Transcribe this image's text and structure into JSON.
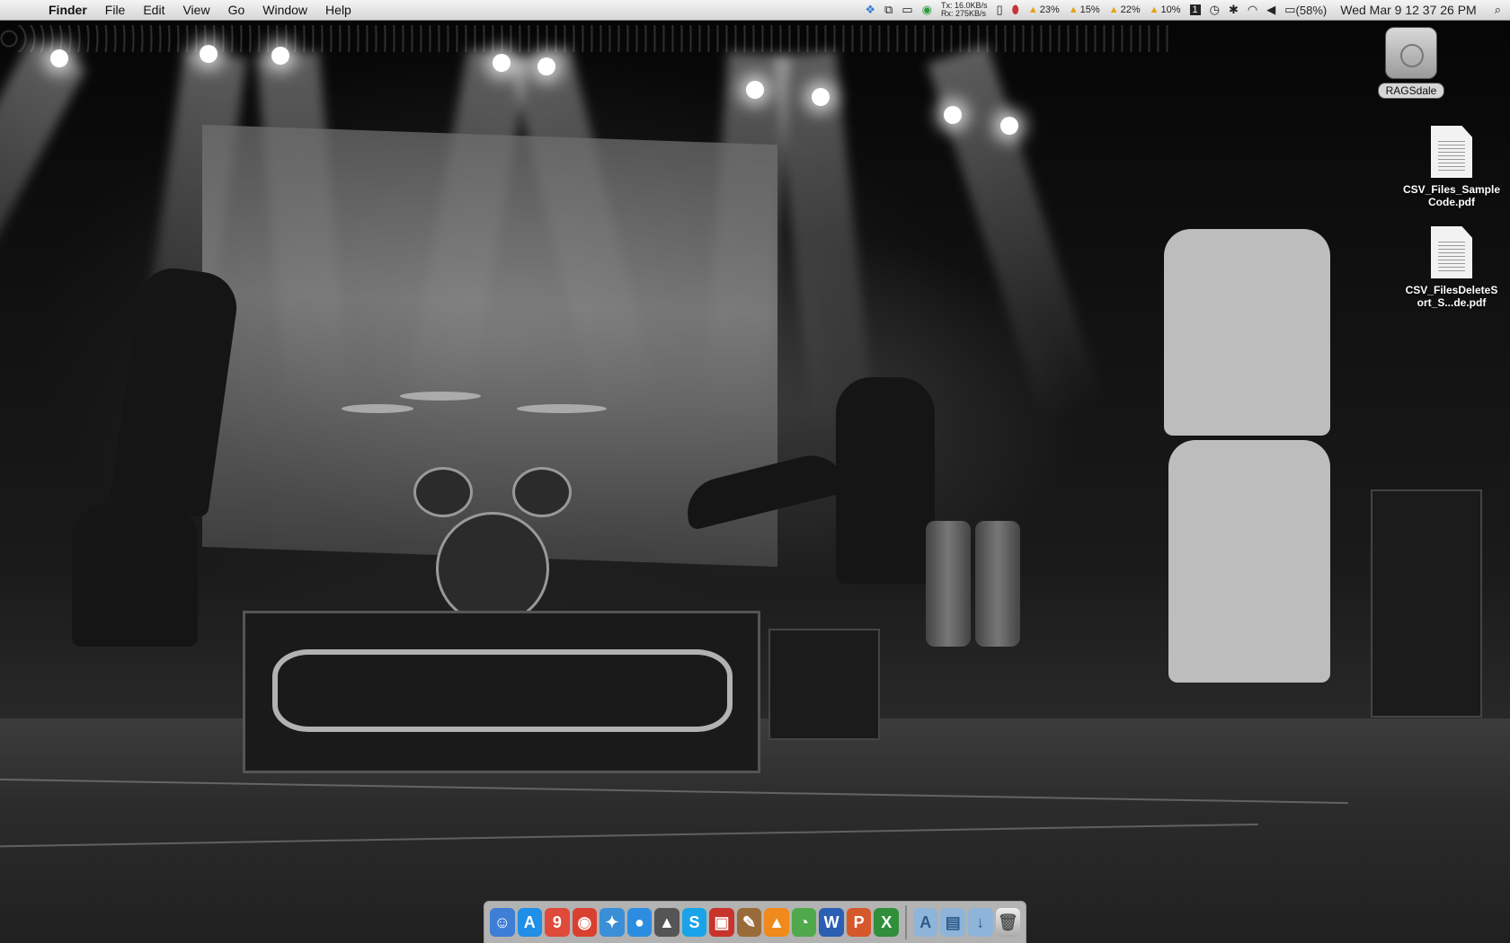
{
  "menubar": {
    "apple": "",
    "app_name": "Finder",
    "items": [
      "File",
      "Edit",
      "View",
      "Go",
      "Window",
      "Help"
    ],
    "net_tx": "Tx: 16.0KB/s",
    "net_rx": "Rx: 275KB/s",
    "cpu": [
      "23%",
      "15%",
      "22%",
      "10%"
    ],
    "spaces": "1",
    "battery": "(58%)",
    "clock": "Wed Mar 9  12 37 26 PM"
  },
  "desktop": {
    "drive_label": "RAGSdale",
    "files": [
      "CSV_Files_SampleCode.pdf",
      "CSV_FilesDeleteSort_S...de.pdf"
    ]
  },
  "dock": {
    "apps": [
      {
        "name": "Finder",
        "glyph": "☺",
        "color": "#3d7ed6"
      },
      {
        "name": "App Store",
        "glyph": "A",
        "color": "#1f8fe8"
      },
      {
        "name": "iCal",
        "glyph": "9",
        "color": "#e04a3a"
      },
      {
        "name": "Chrome",
        "glyph": "◉",
        "color": "#d9402f"
      },
      {
        "name": "Safari",
        "glyph": "✦",
        "color": "#3a8fd6"
      },
      {
        "name": "iChat",
        "glyph": "●",
        "color": "#2c8de0"
      },
      {
        "name": "Adium",
        "glyph": "▲",
        "color": "#555555"
      },
      {
        "name": "Skype",
        "glyph": "S",
        "color": "#1aa3e8"
      },
      {
        "name": "Parallels",
        "glyph": "▣",
        "color": "#c8332b"
      },
      {
        "name": "Script Editor",
        "glyph": "✎",
        "color": "#9a6b3a"
      },
      {
        "name": "VLC",
        "glyph": "▲",
        "color": "#f08a1c"
      },
      {
        "name": "Picasa",
        "glyph": "◔",
        "color": "#4fa94a"
      },
      {
        "name": "Word",
        "glyph": "W",
        "color": "#2b5fb3"
      },
      {
        "name": "PowerPoint",
        "glyph": "P",
        "color": "#d6572a"
      },
      {
        "name": "Excel",
        "glyph": "X",
        "color": "#2f8f3a"
      }
    ],
    "folders": [
      {
        "name": "Applications folder",
        "glyph": "A"
      },
      {
        "name": "Documents folder",
        "glyph": "▤"
      },
      {
        "name": "Downloads folder",
        "glyph": "↓"
      }
    ],
    "trash": "Trash"
  }
}
